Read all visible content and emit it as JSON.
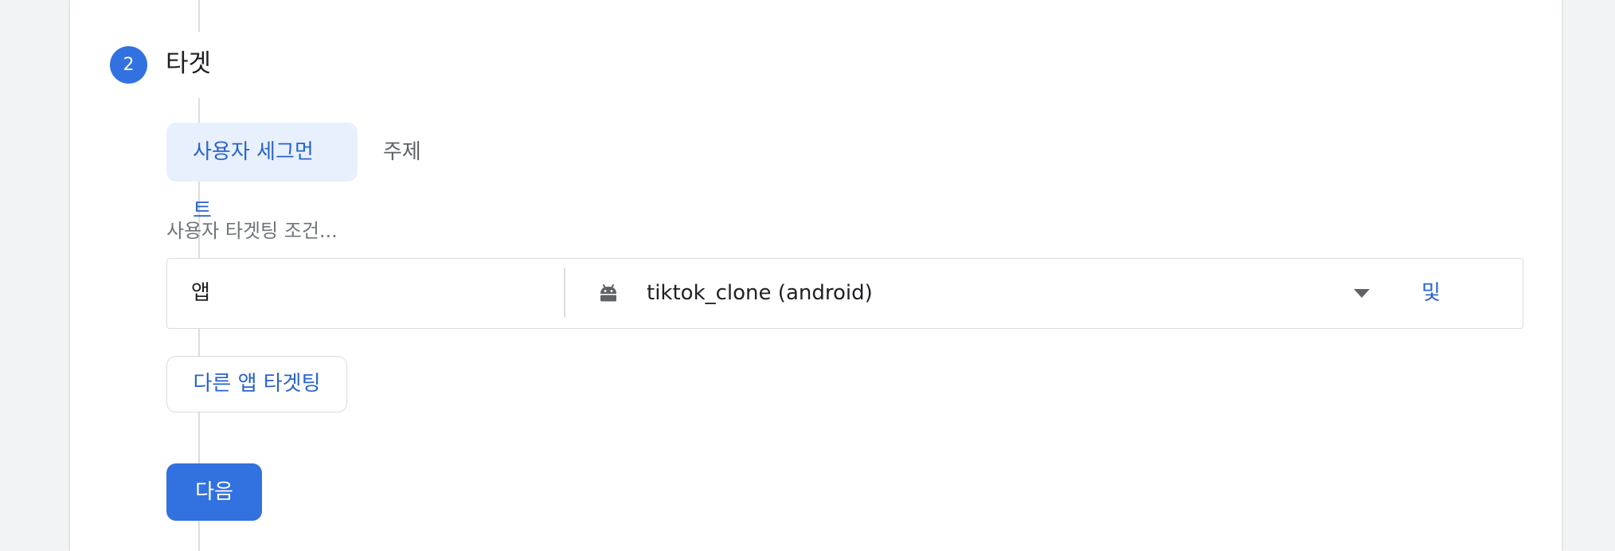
{
  "step": {
    "number": "2",
    "title": "타겟"
  },
  "tabs": [
    {
      "label": "사용자 세그먼트",
      "active": true
    },
    {
      "label": "주제",
      "active": false
    }
  ],
  "criteria_label": "사용자 타겟팅 조건...",
  "condition": {
    "type_label": "앱",
    "icon": "android-icon",
    "value": "tiktok_clone (android)",
    "and_label": "및"
  },
  "buttons": {
    "target_other_app": "다른 앱 타겟팅",
    "next": "다음"
  },
  "colors": {
    "accent": "#3271e0",
    "link": "#2a63c9",
    "chip_bg": "#e8f0fe"
  }
}
